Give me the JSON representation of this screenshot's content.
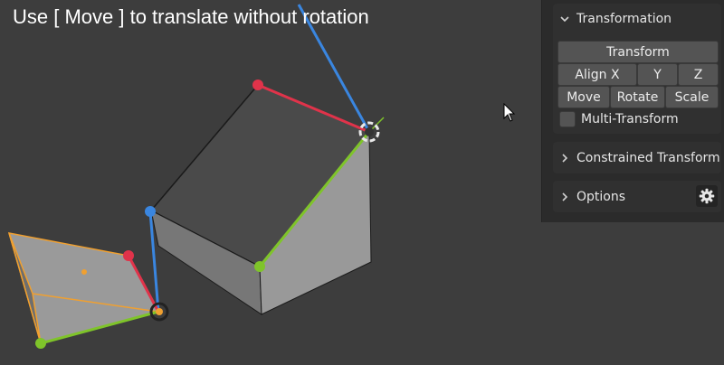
{
  "viewport": {
    "caption": "Use [ Move ] to translate without rotation"
  },
  "panel": {
    "transformation": {
      "title": "Transformation",
      "transform_label": "Transform",
      "align_x_label": "Align X",
      "y_label": "Y",
      "z_label": "Z",
      "move_label": "Move",
      "rotate_label": "Rotate",
      "scale_label": "Scale",
      "multi_transform_label": "Multi-Transform",
      "multi_transform_checked": false
    },
    "constrained": {
      "title": "Constrained Transform"
    },
    "options": {
      "title": "Options"
    }
  },
  "icons": {
    "expanded": "chevron-down-icon",
    "collapsed": "chevron-right-icon",
    "settings": "gear-icon",
    "cursor": "mouse-cursor-icon"
  },
  "colors": {
    "axis_x": "#e0334a",
    "axis_y": "#7fc42a",
    "axis_z": "#3a86e0",
    "selection": "#f0a030",
    "panel_bg": "#2b2b2b",
    "viewport_bg": "#3d3d3d"
  }
}
